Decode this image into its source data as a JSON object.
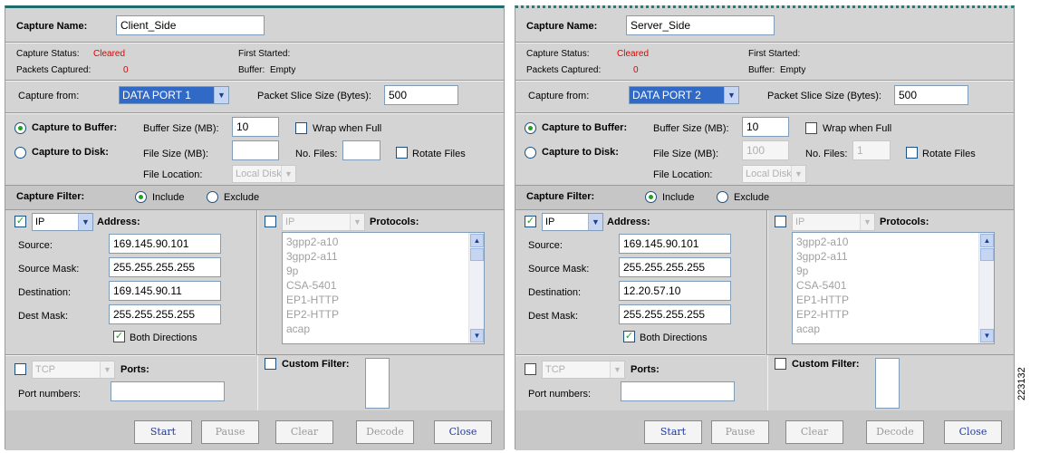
{
  "panels": [
    {
      "capture_name_label": "Capture Name:",
      "capture_name": "Client_Side",
      "capture_status_label": "Capture Status:",
      "capture_status": "Cleared",
      "first_started_label": "First Started:",
      "packets_captured_label": "Packets Captured:",
      "packets_captured": "0",
      "buffer_label": "Buffer:",
      "buffer": "Empty",
      "capture_from_label": "Capture from:",
      "capture_from": "DATA PORT 1",
      "packet_slice_label": "Packet Slice Size (Bytes):",
      "packet_slice": "500",
      "capture_to_buffer_label": "Capture to Buffer:",
      "buffer_size_label": "Buffer Size (MB):",
      "buffer_size": "10",
      "wrap_label": "Wrap when Full",
      "capture_to_disk_label": "Capture to Disk:",
      "file_size_label": "File Size (MB):",
      "file_size": "",
      "no_files_label": "No. Files:",
      "no_files": "",
      "rotate_label": "Rotate Files",
      "file_location_label": "File Location:",
      "file_location": "Local Disk",
      "capture_filter_label": "Capture Filter:",
      "include_label": "Include",
      "exclude_label": "Exclude",
      "address_type": "IP",
      "address_label": "Address:",
      "source_label": "Source:",
      "source": "169.145.90.101",
      "source_mask_label": "Source Mask:",
      "source_mask": "255.255.255.255",
      "destination_label": "Destination:",
      "destination": "169.145.90.11",
      "dest_mask_label": "Dest Mask:",
      "dest_mask": "255.255.255.255",
      "both_directions_label": "Both Directions",
      "protocol_type": "IP",
      "protocols_label": "Protocols:",
      "protocols": [
        "3gpp2-a10",
        "3gpp2-a11",
        "9p",
        "CSA-5401",
        "EP1-HTTP",
        "EP2-HTTP",
        "acap"
      ],
      "port_type": "TCP",
      "ports_label": "Ports:",
      "port_numbers_label": "Port numbers:",
      "port_numbers": "",
      "custom_filter_label": "Custom Filter:",
      "buttons": {
        "start": "Start",
        "pause": "Pause",
        "clear": "Clear",
        "decode": "Decode",
        "close": "Close"
      }
    },
    {
      "capture_name_label": "Capture Name:",
      "capture_name": "Server_Side",
      "capture_status_label": "Capture Status:",
      "capture_status": "Cleared",
      "first_started_label": "First Started:",
      "packets_captured_label": "Packets Captured:",
      "packets_captured": "0",
      "buffer_label": "Buffer:",
      "buffer": "Empty",
      "capture_from_label": "Capture from:",
      "capture_from": "DATA PORT 2",
      "packet_slice_label": "Packet Slice Size (Bytes):",
      "packet_slice": "500",
      "capture_to_buffer_label": "Capture to Buffer:",
      "buffer_size_label": "Buffer Size (MB):",
      "buffer_size": "10",
      "wrap_label": "Wrap when Full",
      "capture_to_disk_label": "Capture to Disk:",
      "file_size_label": "File Size (MB):",
      "file_size": "100",
      "no_files_label": "No. Files:",
      "no_files": "1",
      "rotate_label": "Rotate Files",
      "file_location_label": "File Location:",
      "file_location": "Local Disk",
      "capture_filter_label": "Capture Filter:",
      "include_label": "Include",
      "exclude_label": "Exclude",
      "address_type": "IP",
      "address_label": "Address:",
      "source_label": "Source:",
      "source": "169.145.90.101",
      "source_mask_label": "Source Mask:",
      "source_mask": "255.255.255.255",
      "destination_label": "Destination:",
      "destination": "12.20.57.10",
      "dest_mask_label": "Dest Mask:",
      "dest_mask": "255.255.255.255",
      "both_directions_label": "Both Directions",
      "protocol_type": "IP",
      "protocols_label": "Protocols:",
      "protocols": [
        "3gpp2-a10",
        "3gpp2-a11",
        "9p",
        "CSA-5401",
        "EP1-HTTP",
        "EP2-HTTP",
        "acap"
      ],
      "port_type": "TCP",
      "ports_label": "Ports:",
      "port_numbers_label": "Port numbers:",
      "port_numbers": "",
      "custom_filter_label": "Custom Filter:",
      "buttons": {
        "start": "Start",
        "pause": "Pause",
        "clear": "Clear",
        "decode": "Decode",
        "close": "Close"
      }
    }
  ],
  "figure_number": "223132",
  "colors": {
    "header_bar": "#1f6b6b",
    "status_red": "#e00000",
    "selected_blue": "#3169c6",
    "check_green": "#21a121"
  }
}
